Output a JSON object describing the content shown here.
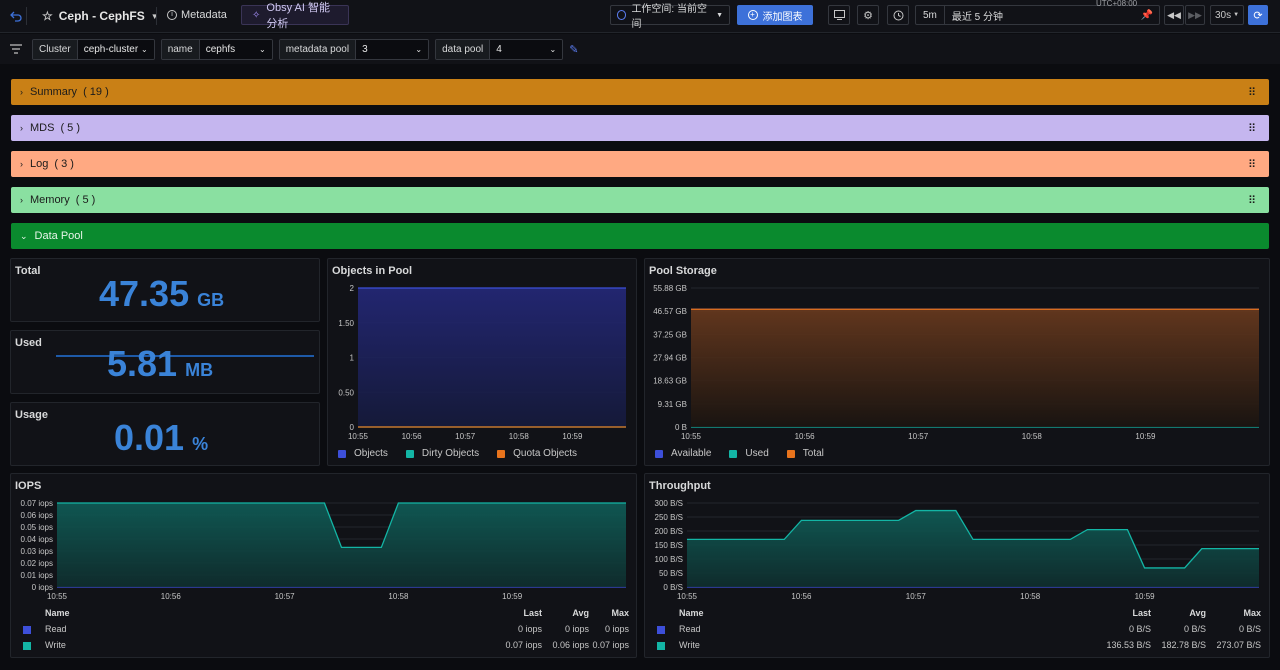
{
  "topbar": {
    "dashboard_title": "Ceph - CephFS",
    "metadata_label": "Metadata",
    "ai_label": "Obsy AI 智能分析",
    "workspace_label": "工作空间: 当前空间",
    "add_panel_label": "添加图表",
    "refresh_short": "5m",
    "time_range_label": "最近 5 分钟",
    "timezone": "UTC+08:00",
    "refresh_interval": "30s"
  },
  "variables": [
    {
      "label": "Cluster",
      "value": "ceph-cluster"
    },
    {
      "label": "name",
      "value": "cephfs"
    },
    {
      "label": "metadata pool",
      "value": "3"
    },
    {
      "label": "data pool",
      "value": "4"
    }
  ],
  "rows": [
    {
      "title": "Summary",
      "count": "( 19 )",
      "color": "#c98016"
    },
    {
      "title": "MDS",
      "count": "( 5 )",
      "color": "#c5b6ef"
    },
    {
      "title": "Log",
      "count": "( 3 )",
      "color": "#ffa982"
    },
    {
      "title": "Memory",
      "count": "( 5 )",
      "color": "#8ae0a1"
    },
    {
      "title": "Data Pool",
      "count": "",
      "color": "#0a8a2e"
    }
  ],
  "stats": {
    "total": {
      "title": "Total",
      "value": "47.35",
      "unit": "GB"
    },
    "used": {
      "title": "Used",
      "value": "5.81",
      "unit": "MB"
    },
    "usage": {
      "title": "Usage",
      "value": "0.01",
      "unit": "%"
    }
  },
  "panels": {
    "objects_title": "Objects in Pool",
    "storage_title": "Pool Storage",
    "iops_title": "IOPS",
    "throughput_title": "Throughput"
  },
  "legend_table_headers": {
    "name": "Name",
    "last": "Last",
    "avg": "Avg",
    "max": "Max"
  },
  "colors": {
    "blue": "#3d4fd9",
    "teal": "#13b5a5",
    "orange": "#e8731c",
    "stat": "#3a83d8"
  },
  "chart_data": [
    {
      "type": "area",
      "title": "Objects in Pool",
      "x": [
        "10:55",
        "10:56",
        "10:57",
        "10:58",
        "10:59"
      ],
      "yticks": [
        "2",
        "1.50",
        "1",
        "0.50",
        "0"
      ],
      "ylim": [
        0,
        2
      ],
      "series": [
        {
          "name": "Objects",
          "color": "#3d4fd9",
          "values": [
            2,
            2,
            2,
            2,
            2,
            2
          ]
        },
        {
          "name": "Dirty Objects",
          "color": "#13b5a5",
          "values": [
            0,
            0,
            0,
            0,
            0,
            0
          ]
        },
        {
          "name": "Quota Objects",
          "color": "#e8731c",
          "values": [
            0,
            0,
            0,
            0,
            0,
            0
          ]
        }
      ],
      "legend": "bottom"
    },
    {
      "type": "area",
      "title": "Pool Storage",
      "x": [
        "10:55",
        "10:56",
        "10:57",
        "10:58",
        "10:59"
      ],
      "yticks": [
        "55.88 GB",
        "46.57 GB",
        "37.25 GB",
        "27.94 GB",
        "18.63 GB",
        "9.31 GB",
        "0 B"
      ],
      "ylim": [
        0,
        55.88
      ],
      "series": [
        {
          "name": "Available",
          "color": "#3d4fd9",
          "values": [
            47.35,
            47.35,
            47.35,
            47.35,
            47.35,
            47.35
          ]
        },
        {
          "name": "Used",
          "color": "#13b5a5",
          "values": [
            0.006,
            0.006,
            0.006,
            0.006,
            0.006,
            0.006
          ]
        },
        {
          "name": "Total",
          "color": "#e8731c",
          "values": [
            47.35,
            47.35,
            47.35,
            47.35,
            47.35,
            47.35
          ]
        }
      ],
      "legend": "bottom"
    },
    {
      "type": "area",
      "title": "IOPS",
      "x": [
        "10:55",
        "10:56",
        "10:57",
        "10:58",
        "10:59"
      ],
      "yticks": [
        "0.07 iops",
        "0.06 iops",
        "0.05 iops",
        "0.04 iops",
        "0.03 iops",
        "0.02 iops",
        "0.01 iops",
        "0 iops"
      ],
      "ylim": [
        0,
        0.07
      ],
      "series": [
        {
          "name": "Read",
          "color": "#3d4fd9",
          "last": "0 iops",
          "avg": "0 iops",
          "max": "0 iops",
          "points": [
            [
              0,
              0
            ],
            [
              5,
              0
            ]
          ]
        },
        {
          "name": "Write",
          "color": "#13b5a5",
          "last": "0.07 iops",
          "avg": "0.06 iops",
          "max": "0.07 iops",
          "points": [
            [
              0,
              0.07
            ],
            [
              2.35,
              0.07
            ],
            [
              2.5,
              0.033
            ],
            [
              2.85,
              0.033
            ],
            [
              3.0,
              0.07
            ],
            [
              5,
              0.07
            ]
          ]
        }
      ],
      "legend": "bottom-table"
    },
    {
      "type": "area",
      "title": "Throughput",
      "x": [
        "10:55",
        "10:56",
        "10:57",
        "10:58",
        "10:59"
      ],
      "yticks": [
        "300 B/S",
        "250 B/S",
        "200 B/S",
        "150 B/S",
        "100 B/S",
        "50 B/S",
        "0 B/S"
      ],
      "ylim": [
        0,
        300
      ],
      "series": [
        {
          "name": "Read",
          "color": "#3d4fd9",
          "last": "0 B/S",
          "avg": "0 B/S",
          "max": "0 B/S",
          "points": [
            [
              0,
              0
            ],
            [
              5,
              0
            ]
          ]
        },
        {
          "name": "Write",
          "color": "#13b5a5",
          "last": "136.53 B/S",
          "avg": "182.78 B/S",
          "max": "273.07 B/S",
          "points": [
            [
              0,
              170
            ],
            [
              0.85,
              170
            ],
            [
              1.0,
              238
            ],
            [
              1.85,
              238
            ],
            [
              2.0,
              273
            ],
            [
              2.35,
              273
            ],
            [
              2.5,
              170
            ],
            [
              3.35,
              170
            ],
            [
              3.5,
              205
            ],
            [
              3.85,
              205
            ],
            [
              4.0,
              68
            ],
            [
              4.35,
              68
            ],
            [
              4.5,
              137
            ],
            [
              5,
              137
            ]
          ]
        }
      ],
      "legend": "bottom-table"
    }
  ]
}
